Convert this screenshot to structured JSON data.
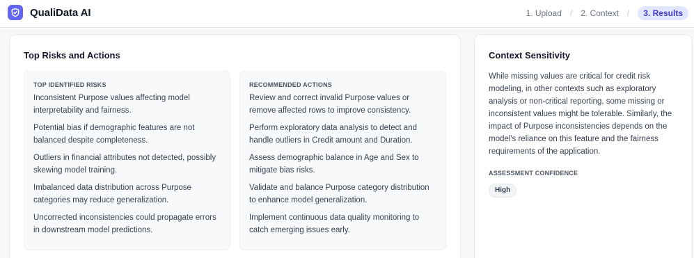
{
  "app": {
    "name": "QualiData AI",
    "logo_icon": "shield-check-icon",
    "accent": "#6366f1"
  },
  "steps": [
    {
      "label": "1. Upload",
      "active": false
    },
    {
      "label": "2. Context",
      "active": false
    },
    {
      "label": "3. Results",
      "active": true
    }
  ],
  "step_separator": "/",
  "risks_card": {
    "title": "Top Risks and Actions",
    "risks": {
      "heading": "TOP IDENTIFIED RISKS",
      "items": [
        "Inconsistent Purpose values affecting model interpretability and fairness.",
        "Potential bias if demographic features are not balanced despite completeness.",
        "Outliers in financial attributes not detected, possibly skewing model training.",
        "Imbalanced data distribution across Purpose categories may reduce generalization.",
        "Uncorrected inconsistencies could propagate errors in downstream model predictions."
      ]
    },
    "actions": {
      "heading": "RECOMMENDED ACTIONS",
      "items": [
        "Review and correct invalid Purpose values or remove affected rows to improve consistency.",
        "Perform exploratory data analysis to detect and handle outliers in Credit amount and Duration.",
        "Assess demographic balance in Age and Sex to mitigate bias risks.",
        "Validate and balance Purpose category distribution to enhance model generalization.",
        "Implement continuous data quality monitoring to catch emerging issues early."
      ]
    }
  },
  "context_card": {
    "title": "Context Sensitivity",
    "body": "While missing values are critical for credit risk modeling, in other contexts such as exploratory analysis or non-critical reporting, some missing or inconsistent values might be tolerable. Similarly, the impact of Purpose inconsistencies depends on the model's reliance on this feature and the fairness requirements of the application.",
    "confidence_label": "ASSESSMENT CONFIDENCE",
    "confidence_value": "High"
  }
}
